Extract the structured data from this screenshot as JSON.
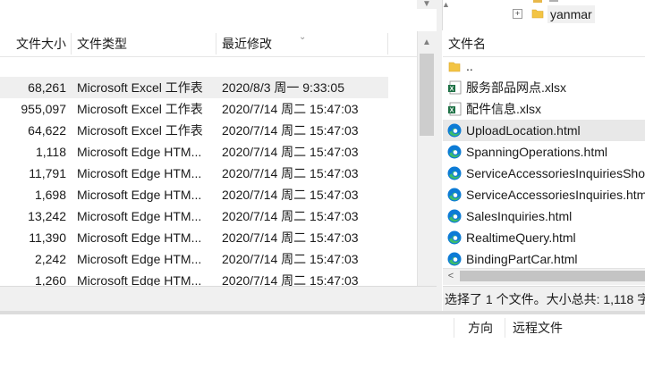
{
  "left_pane": {
    "columns": {
      "size": "文件大小",
      "type": "文件类型",
      "modified": "最近修改"
    },
    "rows": [
      {
        "size": "68,261",
        "type": "Microsoft Excel 工作表",
        "modified": "2020/8/3 周一 9:33:05",
        "selected": true
      },
      {
        "size": "955,097",
        "type": "Microsoft Excel 工作表",
        "modified": "2020/7/14 周二 15:47:03"
      },
      {
        "size": "64,622",
        "type": "Microsoft Excel 工作表",
        "modified": "2020/7/14 周二 15:47:03"
      },
      {
        "size": "1,118",
        "type": "Microsoft Edge HTM...",
        "modified": "2020/7/14 周二 15:47:03"
      },
      {
        "size": "11,791",
        "type": "Microsoft Edge HTM...",
        "modified": "2020/7/14 周二 15:47:03"
      },
      {
        "size": "1,698",
        "type": "Microsoft Edge HTM...",
        "modified": "2020/7/14 周二 15:47:03"
      },
      {
        "size": "13,242",
        "type": "Microsoft Edge HTM...",
        "modified": "2020/7/14 周二 15:47:03"
      },
      {
        "size": "11,390",
        "type": "Microsoft Edge HTM...",
        "modified": "2020/7/14 周二 15:47:03"
      },
      {
        "size": "2,242",
        "type": "Microsoft Edge HTM...",
        "modified": "2020/7/14 周二 15:47:03"
      },
      {
        "size": "1,260",
        "type": "Microsoft Edge HTM...",
        "modified": "2020/7/14 周二 15:47:03"
      }
    ]
  },
  "right_pane": {
    "tree": {
      "folder_label": "yanmar"
    },
    "column_name": "文件名",
    "files": [
      {
        "name": "..",
        "icon": "folder-icon"
      },
      {
        "name": "服务部品网点.xlsx",
        "icon": "excel-icon"
      },
      {
        "name": "配件信息.xlsx",
        "icon": "excel-icon"
      },
      {
        "name": "UploadLocation.html",
        "icon": "edge-icon",
        "selected": true
      },
      {
        "name": "SpanningOperations.html",
        "icon": "edge-icon"
      },
      {
        "name": "ServiceAccessoriesInquiriesSho",
        "icon": "edge-icon"
      },
      {
        "name": "ServiceAccessoriesInquiries.htm",
        "icon": "edge-icon"
      },
      {
        "name": "SalesInquiries.html",
        "icon": "edge-icon"
      },
      {
        "name": "RealtimeQuery.html",
        "icon": "edge-icon"
      },
      {
        "name": "BindingPartCar.html",
        "icon": "edge-icon"
      }
    ],
    "status": "选择了 1 个文件。大小总共: 1,118 字"
  },
  "queue": {
    "columns": {
      "direction": "方向",
      "remote_file": "远程文件"
    }
  },
  "colors": {
    "excel_green": "#1d7044",
    "edge_blue": "#0c7bd6",
    "edge_green": "#3cbc6b",
    "folder_yellow": "#f3c443"
  }
}
